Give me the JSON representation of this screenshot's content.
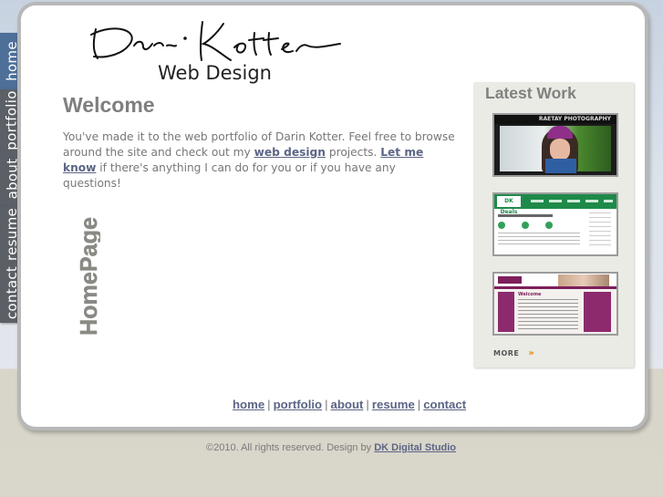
{
  "tabs": [
    {
      "label": "home",
      "active": true
    },
    {
      "label": "portfolio",
      "active": false
    },
    {
      "label": "about",
      "active": false
    },
    {
      "label": "resume",
      "active": false
    },
    {
      "label": "contact",
      "active": false
    }
  ],
  "logo": {
    "signature": "Darin Kotter",
    "subtitle": "Web Design"
  },
  "main": {
    "heading": "Welcome",
    "intro_part1": "You've made it to the web portfolio of Darin Kotter. Feel free to browse around the site and check out my ",
    "link_web_design": "web design",
    "intro_part2": " projects. ",
    "link_let_me_know": "Let me know",
    "intro_part3": " if there's anything I can do for you or if you have any questions!",
    "vertical_label": "HomePage"
  },
  "latest_work": {
    "title": "Latest Work",
    "thumbs": [
      {
        "caption": "RAETAY PHOTOGRAPHY"
      },
      {
        "caption": "DK Deals"
      },
      {
        "caption": "Welcome"
      }
    ],
    "more_label": "MORE",
    "more_arrow": "»"
  },
  "footer_nav": [
    "home",
    "portfolio",
    "about",
    "resume",
    "contact"
  ],
  "footer_separator": "|",
  "copyright": {
    "text": "©2010. All rights reserved. Design by ",
    "link": "DK Digital Studio"
  },
  "colors": {
    "link": "#5c6585",
    "heading": "#7f7f7f",
    "active_tab": "#4d6f98",
    "tab": "#5b6066"
  }
}
